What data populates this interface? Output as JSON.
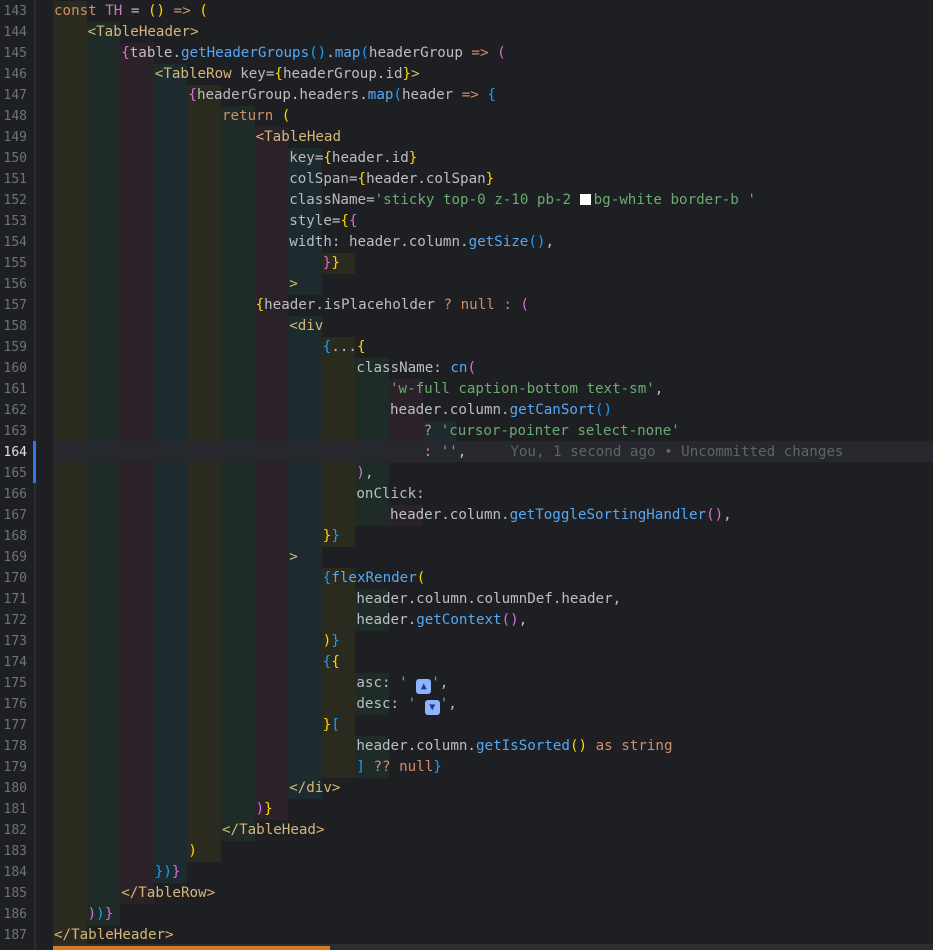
{
  "editor": {
    "current_line": 164,
    "blame_text": "You, 1 second ago • Uncommitted changes",
    "lines": [
      {
        "n": "143",
        "tokens": [
          [
            "k",
            "const "
          ],
          [
            "v",
            "TH"
          ],
          [
            "p",
            " = "
          ],
          [
            "b1",
            "()"
          ],
          [
            "p",
            " "
          ],
          [
            "k",
            "=>"
          ],
          [
            "p",
            " "
          ],
          [
            "b1",
            "("
          ]
        ]
      },
      {
        "n": "144",
        "tokens": [
          [
            "t",
            "<TableHeader"
          ],
          [
            "t",
            ">"
          ]
        ]
      },
      {
        "n": "145",
        "tokens": [
          [
            "b2",
            "{"
          ],
          [
            "p",
            "table."
          ],
          [
            "f",
            "getHeaderGroups"
          ],
          [
            "b3",
            "()"
          ],
          [
            "p",
            "."
          ],
          [
            "f",
            "map"
          ],
          [
            "b3",
            "("
          ],
          [
            "p",
            "headerGroup "
          ],
          [
            "k",
            "=>"
          ],
          [
            "p",
            " "
          ],
          [
            "b2",
            "("
          ]
        ]
      },
      {
        "n": "146",
        "tokens": [
          [
            "t",
            "<TableRow "
          ],
          [
            "a",
            "key"
          ],
          [
            "p",
            "="
          ],
          [
            "b1",
            "{"
          ],
          [
            "p",
            "headerGroup.id"
          ],
          [
            "b1",
            "}"
          ],
          [
            "t",
            ">"
          ]
        ]
      },
      {
        "n": "147",
        "tokens": [
          [
            "b2",
            "{"
          ],
          [
            "p",
            "headerGroup.headers."
          ],
          [
            "f",
            "map"
          ],
          [
            "b3",
            "("
          ],
          [
            "p",
            "header "
          ],
          [
            "k",
            "=>"
          ],
          [
            "p",
            " "
          ],
          [
            "b3",
            "{"
          ]
        ]
      },
      {
        "n": "148",
        "tokens": [
          [
            "k",
            "return"
          ],
          [
            "p",
            " "
          ],
          [
            "b1",
            "("
          ]
        ]
      },
      {
        "n": "149",
        "tokens": [
          [
            "t",
            "<TableHead"
          ]
        ]
      },
      {
        "n": "150",
        "tokens": [
          [
            "a",
            "key"
          ],
          [
            "p",
            "="
          ],
          [
            "b1",
            "{"
          ],
          [
            "p",
            "header.id"
          ],
          [
            "b1",
            "}"
          ]
        ]
      },
      {
        "n": "151",
        "tokens": [
          [
            "a",
            "colSpan"
          ],
          [
            "p",
            "="
          ],
          [
            "b1",
            "{"
          ],
          [
            "p",
            "header.colSpan"
          ],
          [
            "b1",
            "}"
          ]
        ]
      },
      {
        "n": "152",
        "tokens": [
          [
            "a",
            "className"
          ],
          [
            "p",
            "="
          ],
          [
            "s",
            "'sticky top-0 z-10 pb-2 "
          ],
          [
            "sw",
            ""
          ],
          [
            "s",
            "bg-white border-b '"
          ]
        ]
      },
      {
        "n": "153",
        "tokens": [
          [
            "a",
            "style"
          ],
          [
            "p",
            "="
          ],
          [
            "b1",
            "{"
          ],
          [
            "b2",
            "{"
          ]
        ]
      },
      {
        "n": "154",
        "tokens": [
          [
            "p",
            "width: header.column."
          ],
          [
            "f",
            "getSize"
          ],
          [
            "b3",
            "()"
          ],
          [
            "p",
            ","
          ]
        ]
      },
      {
        "n": "155",
        "tokens": [
          [
            "b2",
            "}"
          ],
          [
            "b1",
            "}"
          ]
        ]
      },
      {
        "n": "156",
        "tokens": [
          [
            "t",
            ">"
          ]
        ]
      },
      {
        "n": "157",
        "tokens": [
          [
            "b1",
            "{"
          ],
          [
            "p",
            "header.isPlaceholder "
          ],
          [
            "k",
            "?"
          ],
          [
            "p",
            " "
          ],
          [
            "k",
            "null"
          ],
          [
            "p",
            " "
          ],
          [
            "k",
            ":"
          ],
          [
            "p",
            " "
          ],
          [
            "b2",
            "("
          ]
        ]
      },
      {
        "n": "158",
        "tokens": [
          [
            "t",
            "<div"
          ]
        ]
      },
      {
        "n": "159",
        "tokens": [
          [
            "b3",
            "{"
          ],
          [
            "p",
            "..."
          ],
          [
            "b1",
            "{"
          ]
        ]
      },
      {
        "n": "160",
        "tokens": [
          [
            "p",
            "className: "
          ],
          [
            "f",
            "cn"
          ],
          [
            "b2",
            "("
          ]
        ]
      },
      {
        "n": "161",
        "tokens": [
          [
            "s",
            "'w-full caption-bottom text-sm'"
          ],
          [
            "p",
            ","
          ]
        ]
      },
      {
        "n": "162",
        "tokens": [
          [
            "p",
            "header.column."
          ],
          [
            "f",
            "getCanSort"
          ],
          [
            "b3",
            "()"
          ]
        ]
      },
      {
        "n": "163",
        "tokens": [
          [
            "k",
            "? "
          ],
          [
            "s",
            "'cursor-pointer select-none'"
          ]
        ]
      },
      {
        "n": "164",
        "tokens": [
          [
            "k",
            ": "
          ],
          [
            "s",
            "''"
          ],
          [
            "p",
            ","
          ],
          [
            "blame",
            "blame"
          ]
        ]
      },
      {
        "n": "165",
        "tokens": [
          [
            "b2",
            ")"
          ],
          [
            "p",
            ","
          ]
        ]
      },
      {
        "n": "166",
        "tokens": [
          [
            "p",
            "onClick:"
          ]
        ]
      },
      {
        "n": "167",
        "tokens": [
          [
            "p",
            "header.column."
          ],
          [
            "f",
            "getToggleSortingHandler"
          ],
          [
            "b2",
            "()"
          ],
          [
            "p",
            ","
          ]
        ]
      },
      {
        "n": "168",
        "tokens": [
          [
            "b1",
            "}"
          ],
          [
            "b3",
            "}"
          ]
        ]
      },
      {
        "n": "169",
        "tokens": [
          [
            "t",
            ">"
          ]
        ]
      },
      {
        "n": "170",
        "tokens": [
          [
            "b3",
            "{"
          ],
          [
            "f",
            "flexRender"
          ],
          [
            "b1",
            "("
          ]
        ]
      },
      {
        "n": "171",
        "tokens": [
          [
            "p",
            "header.column.columnDef.header,"
          ]
        ]
      },
      {
        "n": "172",
        "tokens": [
          [
            "p",
            "header."
          ],
          [
            "f",
            "getContext"
          ],
          [
            "b2",
            "()"
          ],
          [
            "p",
            ","
          ]
        ]
      },
      {
        "n": "173",
        "tokens": [
          [
            "b1",
            ")"
          ],
          [
            "b3",
            "}"
          ]
        ]
      },
      {
        "n": "174",
        "tokens": [
          [
            "b3",
            "{"
          ],
          [
            "b1",
            "{"
          ]
        ]
      },
      {
        "n": "175",
        "tokens": [
          [
            "p",
            "asc: "
          ],
          [
            "s",
            "' "
          ],
          [
            "emo",
            "▲"
          ],
          [
            "s",
            "'"
          ],
          [
            "p",
            ","
          ]
        ]
      },
      {
        "n": "176",
        "tokens": [
          [
            "p",
            "desc: "
          ],
          [
            "s",
            "' "
          ],
          [
            "emo",
            "▼"
          ],
          [
            "s",
            "'"
          ],
          [
            "p",
            ","
          ]
        ]
      },
      {
        "n": "177",
        "tokens": [
          [
            "b1",
            "}"
          ],
          [
            "b3",
            "["
          ]
        ]
      },
      {
        "n": "178",
        "tokens": [
          [
            "p",
            "header.column."
          ],
          [
            "f",
            "getIsSorted"
          ],
          [
            "b1",
            "()"
          ],
          [
            "p",
            " "
          ],
          [
            "k",
            "as"
          ],
          [
            "p",
            " "
          ],
          [
            "k",
            "string"
          ]
        ]
      },
      {
        "n": "179",
        "tokens": [
          [
            "b3",
            "]"
          ],
          [
            "p",
            " "
          ],
          [
            "k",
            "??"
          ],
          [
            "p",
            " "
          ],
          [
            "k",
            "null"
          ],
          [
            "b3",
            "}"
          ]
        ]
      },
      {
        "n": "180",
        "tokens": [
          [
            "t",
            "</div>"
          ]
        ]
      },
      {
        "n": "181",
        "tokens": [
          [
            "b2",
            ")"
          ],
          [
            "b1",
            "}"
          ]
        ]
      },
      {
        "n": "182",
        "tokens": [
          [
            "t",
            "</TableHead>"
          ]
        ]
      },
      {
        "n": "183",
        "tokens": [
          [
            "b1",
            ")"
          ]
        ]
      },
      {
        "n": "184",
        "tokens": [
          [
            "b3",
            "}"
          ],
          [
            "b3",
            ")"
          ],
          [
            "b2",
            "}"
          ]
        ]
      },
      {
        "n": "185",
        "tokens": [
          [
            "t",
            "</TableRow>"
          ]
        ]
      },
      {
        "n": "186",
        "tokens": [
          [
            "b2",
            ")"
          ],
          [
            "b3",
            ")"
          ],
          [
            "b2",
            "}"
          ]
        ]
      },
      {
        "n": "187",
        "tokens": [
          [
            "t",
            "</TableHeader>"
          ]
        ]
      }
    ]
  }
}
